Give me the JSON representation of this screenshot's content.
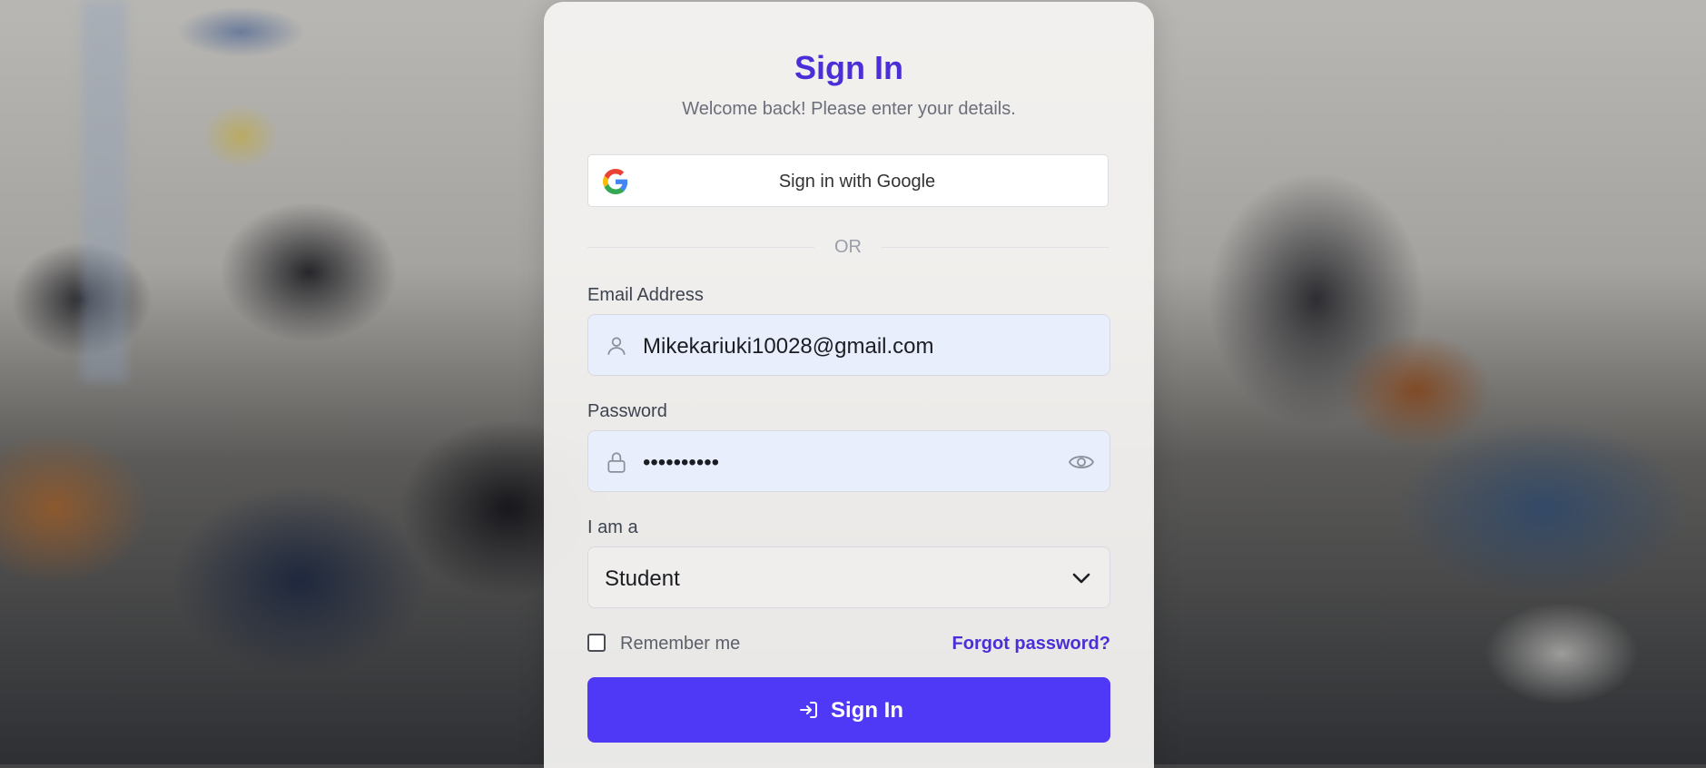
{
  "signin": {
    "title": "Sign In",
    "subtitle": "Welcome back! Please enter your details.",
    "google_label": "Sign in with Google",
    "divider_text": "OR",
    "email_label": "Email Address",
    "email_value": "Mikekariuki10028@gmail.com",
    "password_label": "Password",
    "password_value": "••••••••••",
    "role_label": "I am a",
    "role_value": "Student",
    "remember_label": "Remember me",
    "remember_checked": false,
    "forgot_label": "Forgot password?",
    "submit_label": "Sign In"
  },
  "colors": {
    "accent": "#4a2fd8",
    "button": "#4f38f6",
    "field_bg": "#e8eefc"
  },
  "icons": [
    "google-icon",
    "user-icon",
    "lock-icon",
    "eye-icon",
    "chevron-down-icon",
    "sign-in-icon"
  ]
}
